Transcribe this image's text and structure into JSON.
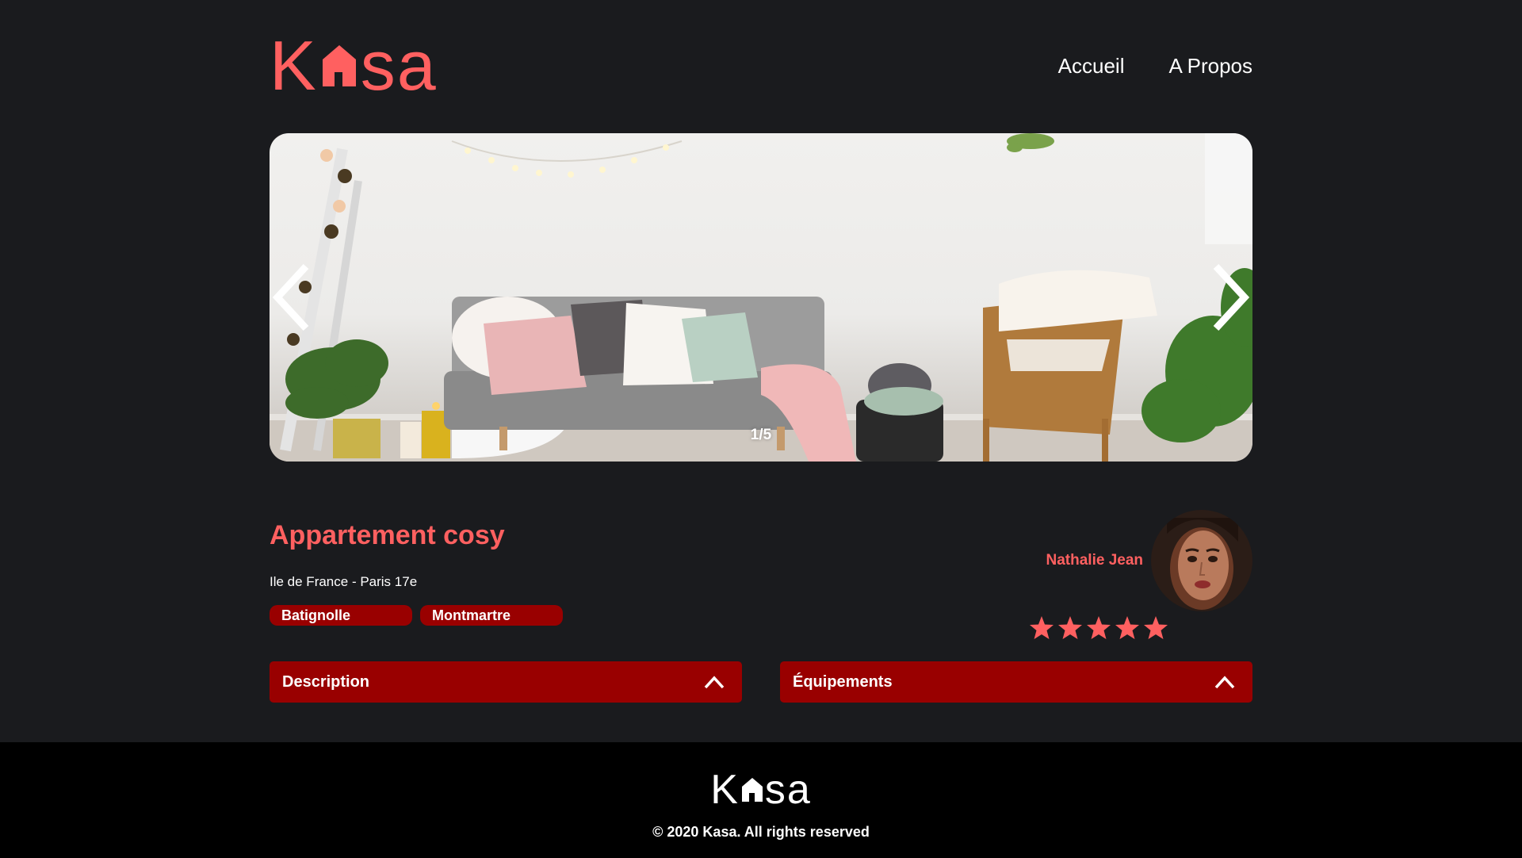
{
  "brand": {
    "logo_letter_1": "K",
    "logo_letter_rest": "sa",
    "color": "#ff6060"
  },
  "nav": {
    "home": "Accueil",
    "about": "A Propos"
  },
  "gallery": {
    "counter": "1/5",
    "prev_icon": "chevron-left-icon",
    "next_icon": "chevron-right-icon"
  },
  "listing": {
    "title": "Appartement cosy",
    "location": "Ile de France - Paris 17e",
    "tags": [
      "Batignolle",
      "Montmartre"
    ],
    "rating": 5,
    "rating_max": 5
  },
  "host": {
    "name": "Nathalie Jean"
  },
  "collapses": {
    "description_label": "Description",
    "equipments_label": "Équipements",
    "icon": "chevron-up-icon"
  },
  "footer": {
    "copyright": "© 2020 Kasa. All rights reserved"
  },
  "colors": {
    "accent": "#ff6060",
    "dark_red": "#990000",
    "background": "#1a1b1e",
    "footer_bg": "#000000"
  }
}
